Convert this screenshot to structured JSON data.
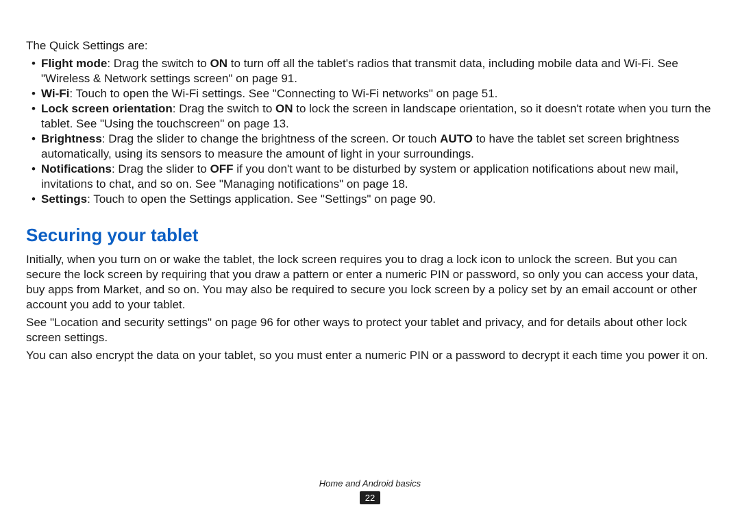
{
  "intro": "The Quick Settings are:",
  "items": [
    {
      "label": "Flight mode",
      "before": ": Drag the switch to ",
      "kw": "ON",
      "after": " to turn off all the tablet's radios that transmit data, including mobile data and Wi-Fi. See \"Wireless & Network settings screen\" on page 91."
    },
    {
      "label": "Wi-Fi",
      "before": ": Touch to open the Wi-Fi settings. See \"Connecting to Wi-Fi networks\" on page 51.",
      "kw": "",
      "after": ""
    },
    {
      "label": "Lock screen orientation",
      "before": ": Drag the switch to ",
      "kw": "ON",
      "after": " to lock the screen in landscape orientation, so it doesn't rotate when you turn the tablet. See \"Using the touchscreen\" on page 13."
    },
    {
      "label": "Brightness",
      "before": ": Drag the slider to change the brightness of the screen. Or touch ",
      "kw": "AUTO",
      "after": " to have the tablet set screen brightness automatically, using its sensors to measure the amount of light in your surroundings."
    },
    {
      "label": "Notifications",
      "before": ": Drag the slider to ",
      "kw": "OFF",
      "after": " if you don't want to be disturbed by system or application notifications about new mail, invitations to chat, and so on. See \"Managing notifications\" on page 18."
    },
    {
      "label": "Settings",
      "before": ": Touch to open the Settings application. See \"Settings\" on page 90.",
      "kw": "",
      "after": ""
    }
  ],
  "section_heading": "Securing your tablet",
  "para1": "Initially, when you turn on or wake the tablet, the lock screen requires you to drag a lock icon to unlock the screen. But you can secure the lock screen by requiring that you draw a pattern or enter a numeric PIN or password, so only you can access your data, buy apps from Market, and so on. You may also be required to secure you lock screen by a policy set by an email account or other account you add to your tablet.",
  "para2": "See \"Location and security settings\" on page 96 for other ways to protect your tablet and privacy, and for details about other lock screen settings.",
  "para3": "You can also encrypt the data on your tablet, so you must enter a numeric PIN or a password to decrypt it each time you power it on.",
  "footer_title": "Home and Android basics",
  "page_number": "22"
}
